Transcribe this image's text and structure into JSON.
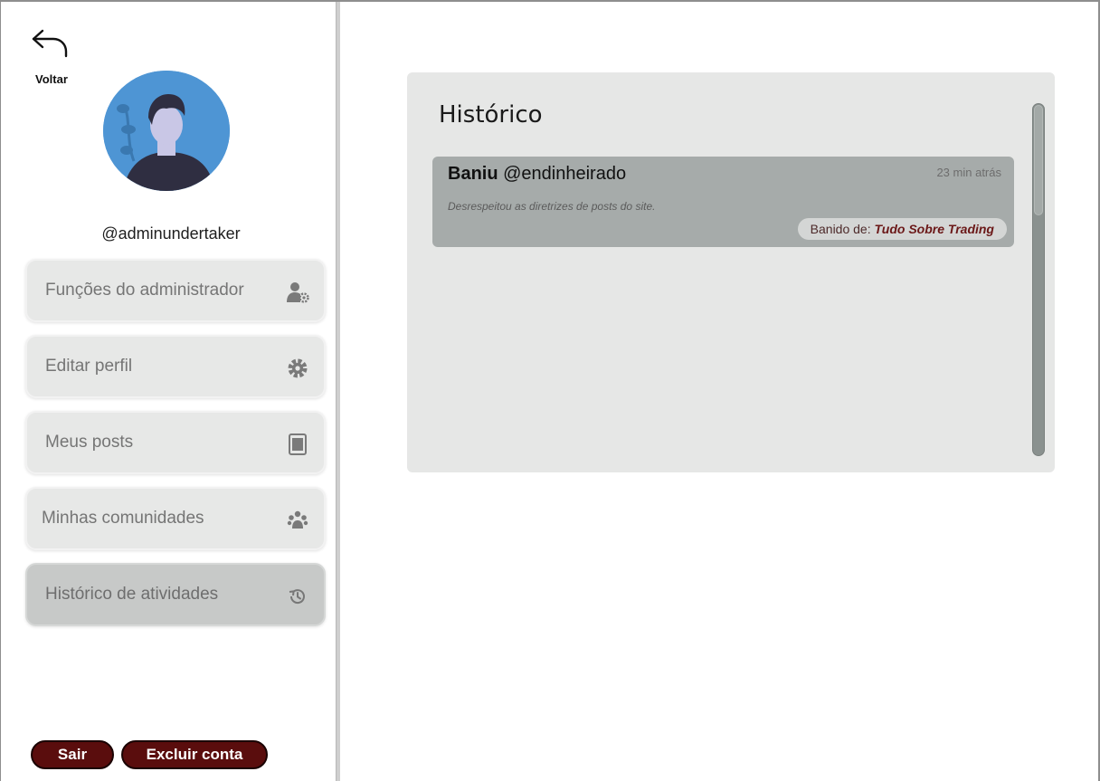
{
  "sidebar": {
    "back_label": "Voltar",
    "username": "@adminundertaker",
    "items": [
      {
        "label": "Funções do administrador",
        "icon": "user-gear-icon"
      },
      {
        "label": "Editar perfil",
        "icon": "gear-icon"
      },
      {
        "label": "Meus posts",
        "icon": "document-icon"
      },
      {
        "label": "Minhas comunidades",
        "icon": "group-icon"
      },
      {
        "label": "Histórico de atividades",
        "icon": "history-icon",
        "active": true
      }
    ],
    "logout_label": "Sair",
    "delete_label": "Excluir conta"
  },
  "panel": {
    "title": "Histórico",
    "entries": [
      {
        "action": "Baniu",
        "target": "@endinheirado",
        "time": "23 min atrás",
        "description": "Desrespeitou as diretrizes de posts do site.",
        "badge_prefix": "Banido de: ",
        "badge_community": "Tudo Sobre Trading"
      }
    ]
  },
  "colors": {
    "button_accent": "#5a0d0d",
    "active_item": "#c7c9c8",
    "entry_bg": "#a6abaa",
    "avatar_bg": "#4e95d4"
  }
}
